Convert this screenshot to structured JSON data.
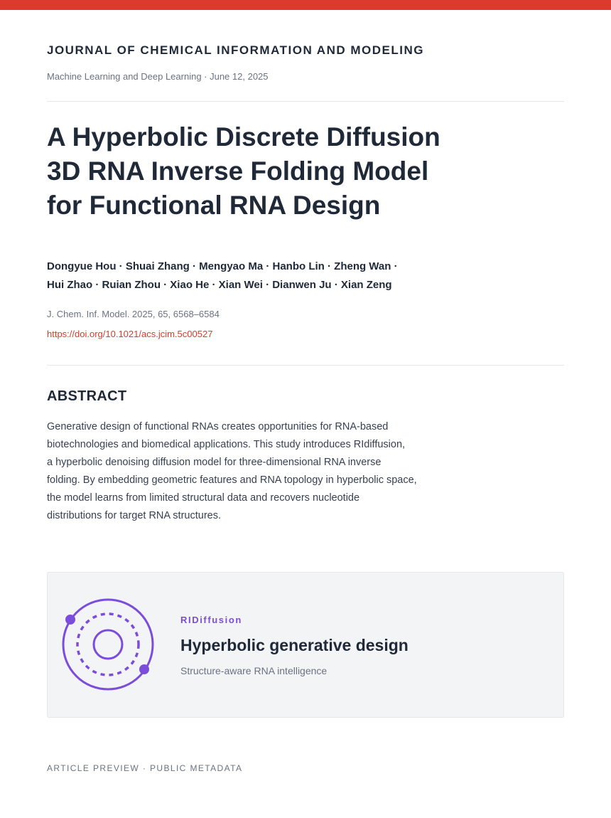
{
  "header": {
    "journal": "JOURNAL OF CHEMICAL INFORMATION AND MODELING",
    "meta": "Machine Learning and Deep Learning · June 12, 2025"
  },
  "article": {
    "title_lines": [
      "A Hyperbolic Discrete Diffusion",
      "3D RNA Inverse Folding Model",
      "for Functional RNA Design"
    ],
    "author_lines": [
      "Dongyue Hou · Shuai Zhang · Mengyao Ma · Hanbo Lin · Zheng Wan ·",
      "Hui Zhao · Ruian Zhou · Xiao He · Xian Wei · Dianwen Ju · Xian Zeng"
    ],
    "citation": "J. Chem. Inf. Model. 2025, 65, 6568–6584",
    "doi": "https://doi.org/10.1021/acs.jcim.5c00527"
  },
  "abstract": {
    "heading": "ABSTRACT",
    "lines": [
      "Generative design of functional RNAs creates opportunities for RNA-based",
      "biotechnologies and biomedical applications. This study introduces RIdiffusion,",
      "a hyperbolic denoising diffusion model for three-dimensional RNA inverse",
      "folding. By embedding geometric features and RNA topology in hyperbolic space,",
      "the model learns from limited structural data and recovers nucleotide",
      "distributions for target RNA structures."
    ]
  },
  "feature_card": {
    "eyebrow": "RIDiffusion",
    "title": "Hyperbolic generative design",
    "subtitle": "Structure-aware RNA intelligence",
    "icon": "orbit-rings-icon"
  },
  "footer": {
    "note": "ARTICLE PREVIEW · PUBLIC METADATA"
  },
  "colors": {
    "accent_red": "#dc3a2c",
    "accent_purple": "#7c4ddb",
    "text_dark": "#1f2937",
    "text_muted": "#6b7280",
    "card_bg": "#f3f4f6"
  }
}
